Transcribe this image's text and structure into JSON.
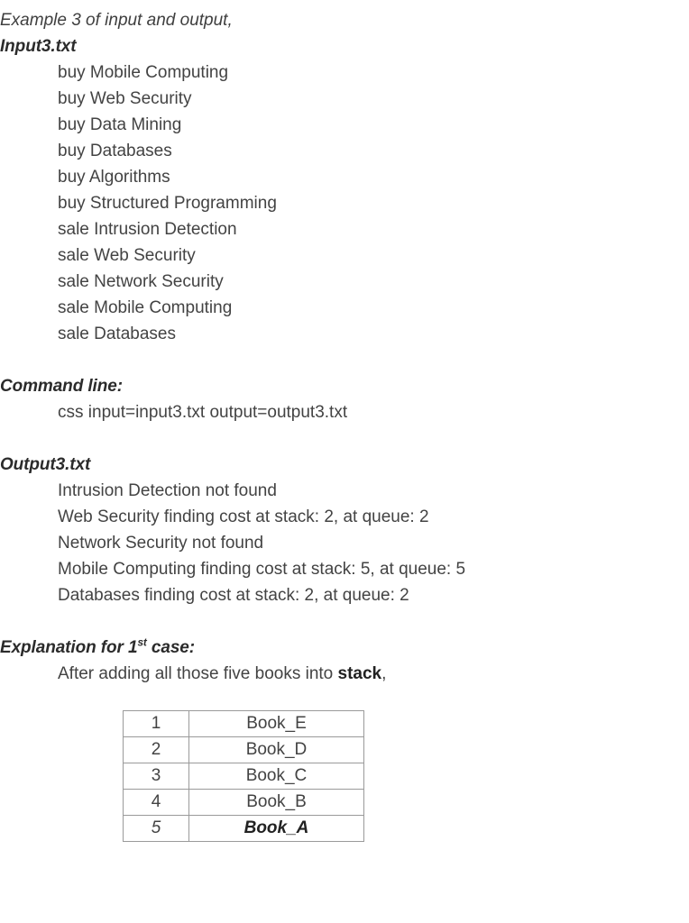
{
  "document": {
    "intro_line": "Example 3 of input and output,",
    "input_heading": "Input3.txt",
    "input_lines": [
      "buy Mobile Computing",
      "buy Web Security",
      "buy Data Mining",
      "buy Databases",
      "buy Algorithms",
      "buy Structured Programming",
      "sale Intrusion Detection",
      "sale Web Security",
      "sale Network Security",
      "sale Mobile Computing",
      "sale Databases"
    ],
    "command_heading": "Command line:",
    "command_text": "css input=input3.txt output=output3.txt",
    "output_heading": "Output3.txt",
    "output_lines": [
      "Intrusion Detection not found",
      "Web Security finding cost at stack: 2, at queue: 2",
      "Network Security not found",
      "Mobile Computing finding cost at stack: 5, at queue: 5",
      "Databases finding cost at stack: 2, at queue: 2"
    ],
    "explanation_heading_pre": "Explanation for 1",
    "explanation_heading_sup": "st",
    "explanation_heading_post": " case:",
    "explanation_text_pre": "After adding all those five books into ",
    "explanation_text_bold": "stack",
    "explanation_text_post": ",",
    "stack_table": {
      "rows": [
        {
          "index": "1",
          "book": "Book_E"
        },
        {
          "index": "2",
          "book": "Book_D"
        },
        {
          "index": "3",
          "book": "Book_C"
        },
        {
          "index": "4",
          "book": "Book_B"
        },
        {
          "index": "5",
          "book": "Book_A"
        }
      ]
    },
    "colors": {
      "text": "#434343",
      "heading": "#222222",
      "table_border": "#9a9a9a",
      "background": "#ffffff"
    }
  }
}
